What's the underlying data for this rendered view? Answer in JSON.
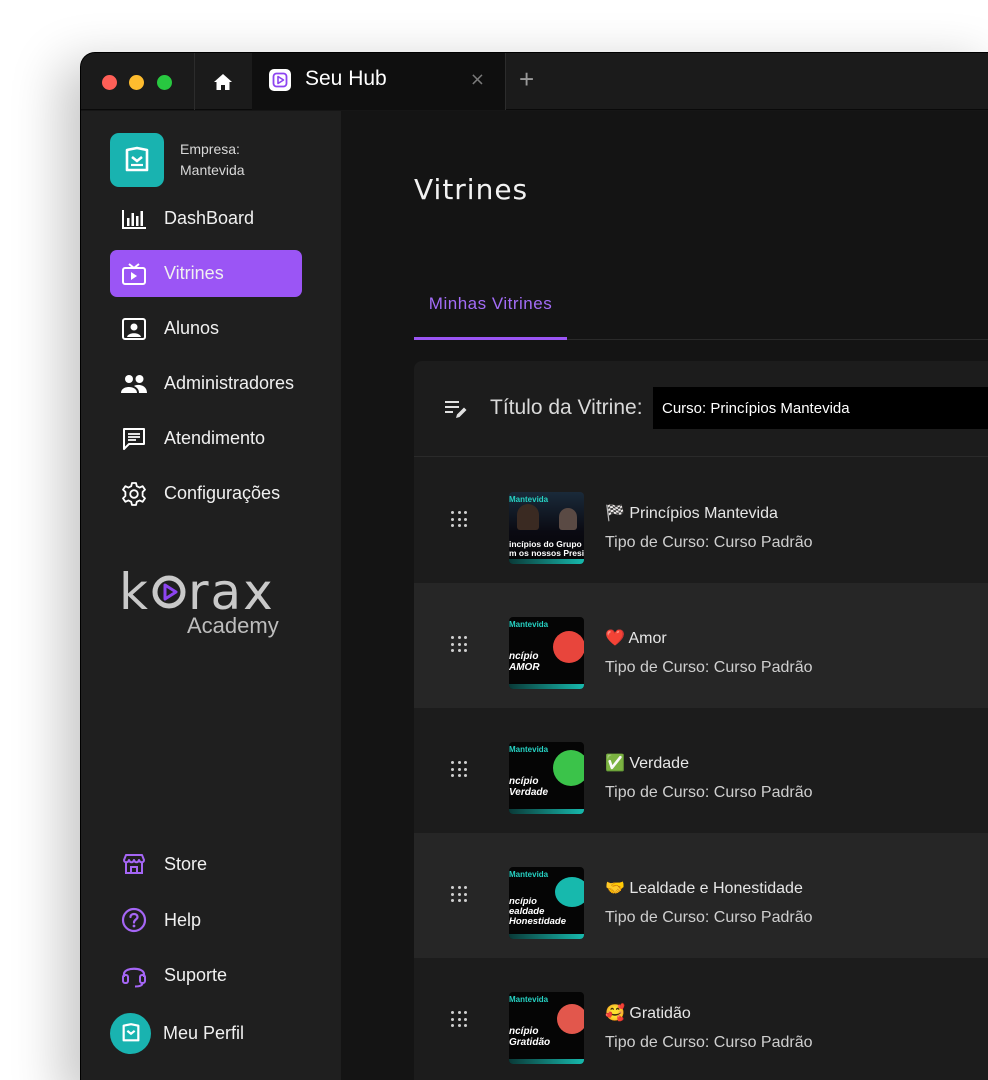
{
  "browser": {
    "tab_title": "Seu Hub",
    "tab_close": "×",
    "new_tab": "+"
  },
  "sidebar": {
    "company_line1": "Empresa:",
    "company_line2": "Mantevida",
    "items": [
      {
        "label": "DashBoard",
        "icon": "bar-chart-icon"
      },
      {
        "label": "Vitrines",
        "icon": "tv-icon",
        "active": true
      },
      {
        "label": "Alunos",
        "icon": "student-icon"
      },
      {
        "label": "Administradores",
        "icon": "people-icon"
      },
      {
        "label": "Atendimento",
        "icon": "chat-icon"
      },
      {
        "label": "Configurações",
        "icon": "gear-icon"
      }
    ],
    "brand_word_left": "k",
    "brand_word_right": "rax",
    "brand_sub": "Academy",
    "bottom_items": [
      {
        "label": "Store",
        "icon": "store-icon"
      },
      {
        "label": "Help",
        "icon": "help-icon"
      },
      {
        "label": "Suporte",
        "icon": "headset-icon"
      },
      {
        "label": "Meu Perfil",
        "icon": "avatar"
      }
    ]
  },
  "main": {
    "title": "Vitrines",
    "tab_label": "Minhas Vitrines",
    "field_label": "Título da Vitrine:",
    "field_value": "Curso: Princípios Mantevida",
    "courses": [
      {
        "name": "🏁 Princípios Mantevida",
        "type": "Tipo de Curso: Curso Padrão",
        "thumb_head": "Mantevida",
        "thumb_text": "incípios do Grupo\nm os nossos Presidente"
      },
      {
        "name": "❤️ Amor",
        "type": "Tipo de Curso: Curso Padrão",
        "thumb_head": "Mantevida",
        "thumb_text": "ncípio\nAMOR"
      },
      {
        "name": "✅ Verdade",
        "type": "Tipo de Curso: Curso Padrão",
        "thumb_head": "Mantevida",
        "thumb_text": "ncípio\nVerdade"
      },
      {
        "name": "🤝 Lealdade e Honestidade",
        "type": "Tipo de Curso: Curso Padrão",
        "thumb_head": "Mantevida",
        "thumb_text": "ncípio\nealdade\nHonestidade"
      },
      {
        "name": "🥰 Gratidão",
        "type": "Tipo de Curso: Curso Padrão",
        "thumb_head": "Mantevida",
        "thumb_text": "ncípio\nGratidão"
      }
    ]
  },
  "colors": {
    "accent": "#9b55f5",
    "brand_teal": "#19b3b0",
    "background": "#141414"
  }
}
